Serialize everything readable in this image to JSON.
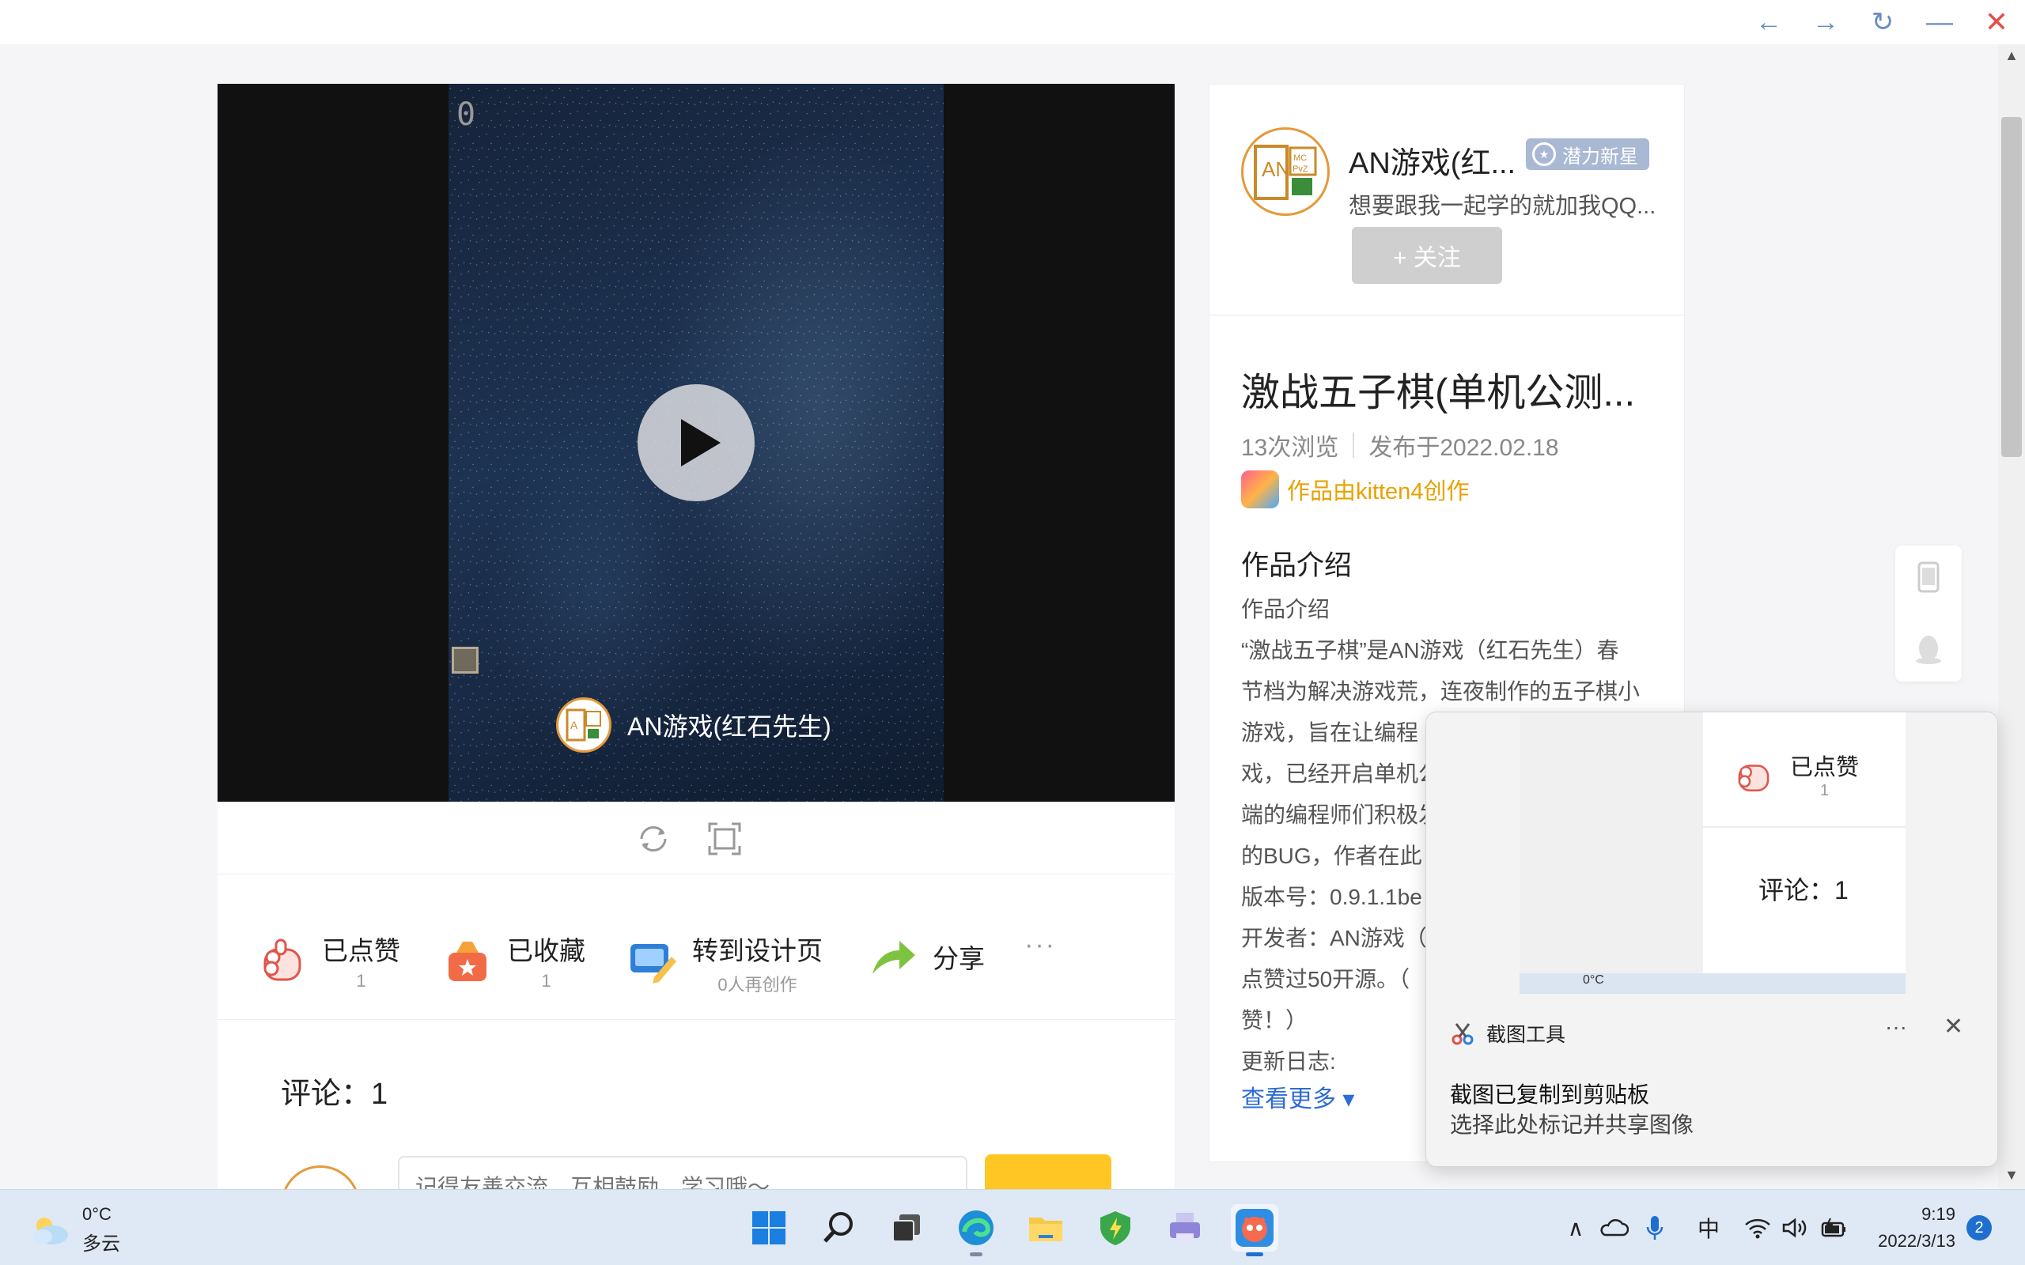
{
  "window": {
    "back_icon": "←",
    "forward_icon": "→",
    "refresh_icon": "↻",
    "minimize_icon": "—",
    "close_icon": "✕"
  },
  "player": {
    "counter": "0",
    "author_name": "AN游戏(红石先生)"
  },
  "actions": {
    "like": {
      "label": "已点赞",
      "count": "1"
    },
    "favorite": {
      "label": "已收藏",
      "count": "1"
    },
    "design": {
      "label": "转到设计页",
      "sub": "0人再创作"
    },
    "share": {
      "label": "分享"
    },
    "more": "···"
  },
  "comments": {
    "title": "评论：1",
    "placeholder": "记得友善交流，互相鼓励，学习哦～"
  },
  "author": {
    "name": "AN游戏(红...",
    "badge": "潜力新星",
    "bio": "想要跟我一起学的就加我QQ...",
    "follow_label": "+ 关注",
    "avatar_text": {
      "line1": "AN",
      "line2": "MC",
      "line3": "PvZ"
    }
  },
  "work": {
    "title": "激战五子棋(单机公测...",
    "views": "13次浏览",
    "published": "发布于2022.02.18",
    "creator": "作品由kitten4创作",
    "section_title": "作品介绍",
    "description": "作品介绍\n“激战五子棋”是AN游戏（红石先生）春\n节档为解决游戏荒，连夜制作的五子棋小\n游戏，旨在让编程\n戏，已经开启单机公\n端的编程师们积极发\n的BUG，作者在此\n版本号：0.9.1.1be\n开发者：AN游戏（\n点赞过50开源。（\n赞！）\n更新日志:",
    "more_link": "查看更多 ▾"
  },
  "toast": {
    "app_name": "截图工具",
    "dots": "···",
    "close": "✕",
    "title": "截图已复制到剪贴板",
    "subtitle": "选择此处标记并共享图像",
    "preview": {
      "like_label": "已点赞",
      "like_count": "1",
      "comment": "评论：1",
      "bar_text": "0°C"
    }
  },
  "taskbar": {
    "weather": {
      "temp": "0°C",
      "condition": "多云"
    },
    "tray": {
      "chevron": "∧",
      "ime": "中"
    },
    "clock": {
      "time": "9:19",
      "date": "2022/3/13"
    },
    "notifications": "2"
  },
  "colors": {
    "accent_blue": "#2d6bd6",
    "creator_orange": "#e8a100",
    "comment_button": "#ffc624",
    "close_red": "#e2504a"
  }
}
